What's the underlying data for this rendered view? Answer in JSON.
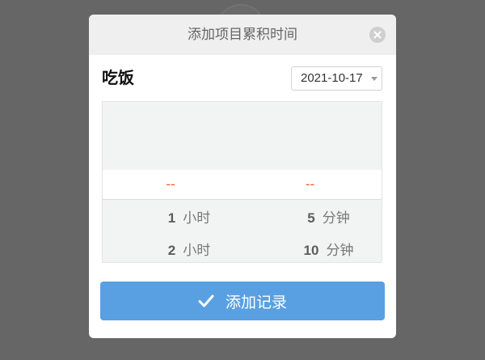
{
  "dialog": {
    "title": "添加项目累积时间",
    "close_icon": "close-circle-icon"
  },
  "project": {
    "name": "吃饭",
    "date": "2021-10-17",
    "date_icon": "caret-down-icon"
  },
  "picker": {
    "hours": {
      "selected": "--",
      "options": [
        {
          "value": "1",
          "unit": "小时"
        },
        {
          "value": "2",
          "unit": "小时"
        }
      ]
    },
    "minutes": {
      "selected": "--",
      "options": [
        {
          "value": "5",
          "unit": "分钟"
        },
        {
          "value": "10",
          "unit": "分钟"
        }
      ]
    }
  },
  "submit_button": {
    "icon": "checkmark-icon",
    "label": "添加记录"
  },
  "colors": {
    "overlay": "#666666",
    "header_bg": "#efefef",
    "picker_bg": "#f2f3f3",
    "selected_text": "#ee5a24",
    "accent": "#58a0e2"
  }
}
